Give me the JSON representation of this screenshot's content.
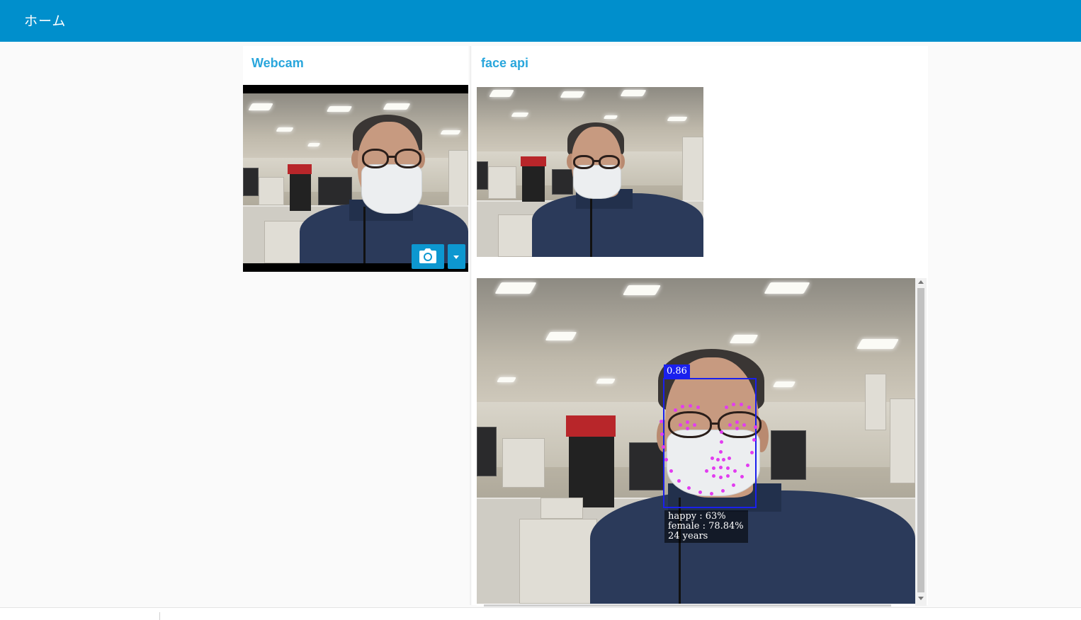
{
  "header": {
    "title": "ホーム"
  },
  "webcam_panel": {
    "title": "Webcam",
    "capture_icon": "camera-icon",
    "dropdown_icon": "caret-down-icon"
  },
  "faceapi_panel": {
    "title": "face api",
    "detection": {
      "score": "0.86",
      "expression": "happy : 63%",
      "gender": "female : 78.84%",
      "age": "24 years"
    }
  },
  "colors": {
    "header_bg": "#008fcc",
    "panel_title": "#29a6dc",
    "button": "#0d97d0",
    "detection_box": "#1a20ee",
    "landmark": "#e23cf0"
  }
}
